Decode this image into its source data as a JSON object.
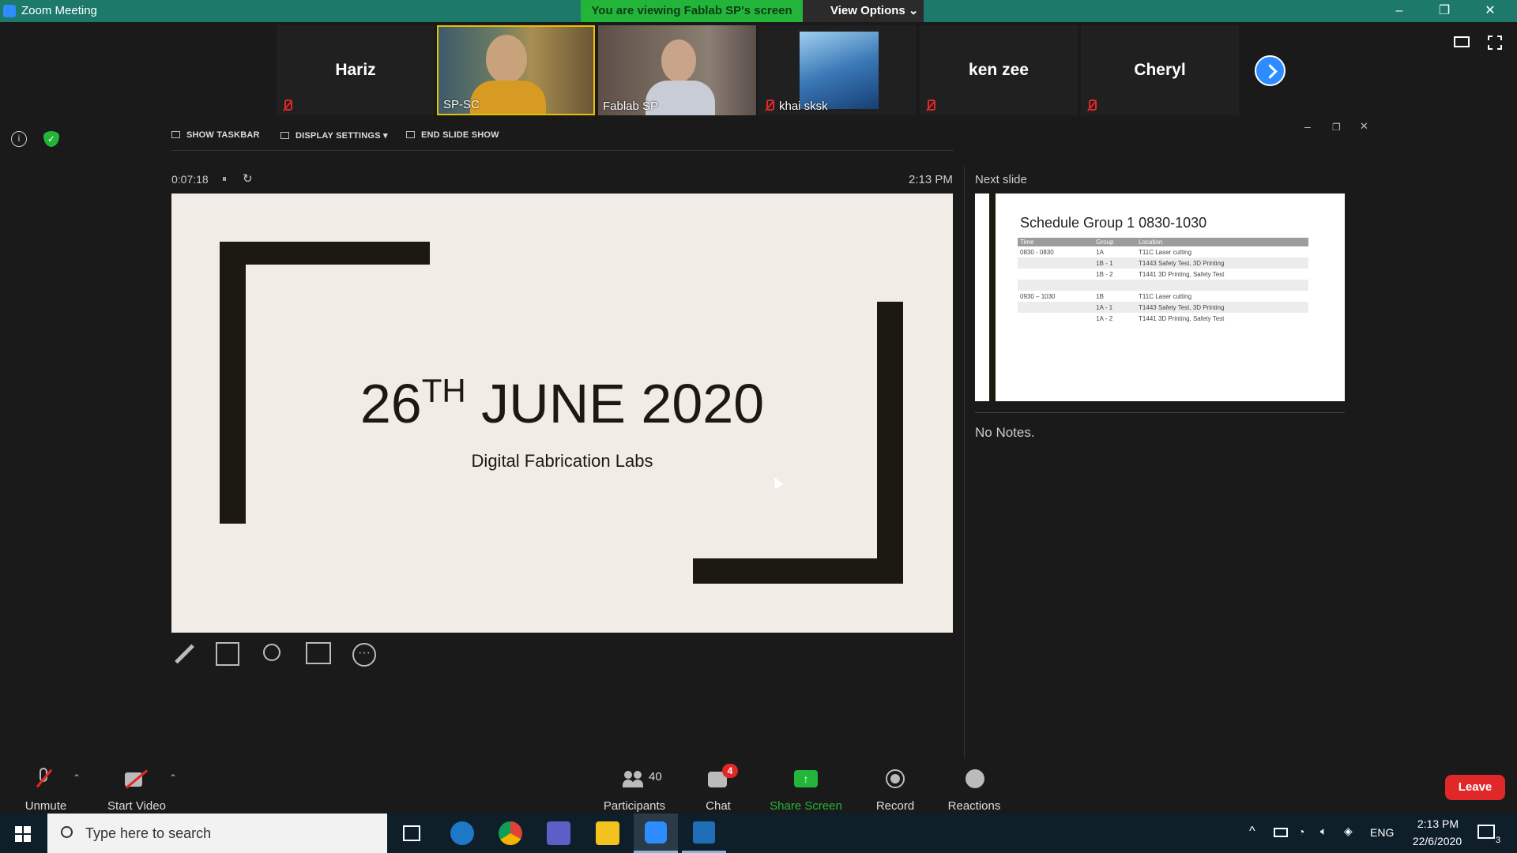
{
  "window": {
    "title": "Zoom Meeting",
    "viewing_banner": "You are viewing Fablab SP's screen",
    "view_options": "View Options ⌄",
    "minimize": "–",
    "restore": "❐",
    "close": "✕"
  },
  "participants_strip": [
    {
      "name": "Hariz",
      "type": "name",
      "muted": true
    },
    {
      "name": "SP-SC",
      "type": "video",
      "muted": false
    },
    {
      "name": "Fablab SP",
      "type": "video",
      "muted": false
    },
    {
      "name": "khai sksk",
      "type": "image",
      "muted": true
    },
    {
      "name": "ken zee",
      "type": "name",
      "muted": true
    },
    {
      "name": "Cheryl",
      "type": "name",
      "muted": true
    }
  ],
  "presenter_controls": {
    "show_taskbar": "SHOW TASKBAR",
    "display_settings": "DISPLAY SETTINGS ▾",
    "end_slide_show": "END SLIDE SHOW",
    "timer": "0:07:18",
    "pause": "⏸",
    "reset": "↻",
    "clock": "2:13 PM",
    "next_slide_label": "Next slide",
    "notes": "No Notes."
  },
  "current_slide": {
    "title_day": "26",
    "title_suffix": "TH",
    "title_rest": " JUNE 2020",
    "subtitle": "Digital Fabrication Labs"
  },
  "next_slide": {
    "title": "Schedule Group 1 0830-1030",
    "headers": [
      "Time",
      "Group",
      "Location"
    ],
    "rows": [
      [
        "0830 - 0830",
        "1A",
        "T11C Laser cutting"
      ],
      [
        "",
        "1B - 1",
        "T1443 Safety Test, 3D Printing"
      ],
      [
        "",
        "1B - 2",
        "T1441 3D Printing, Safety Test"
      ],
      [
        "",
        "",
        ""
      ],
      [
        "0930 – 1030",
        "1B",
        "T11C Laser cutting"
      ],
      [
        "",
        "1A - 1",
        "T1443 Safety Test, 3D Printing"
      ],
      [
        "",
        "1A - 2",
        "T1441 3D Printing, Safety Test"
      ]
    ]
  },
  "toolbar": {
    "unmute": "Unmute",
    "start_video": "Start Video",
    "participants": "Participants",
    "participants_count": "40",
    "chat": "Chat",
    "chat_badge": "4",
    "share_screen": "Share Screen",
    "record": "Record",
    "reactions": "Reactions",
    "leave": "Leave"
  },
  "taskbar": {
    "search_placeholder": "Type here to search",
    "language": "ENG",
    "time": "2:13 PM",
    "date": "22/6/2020",
    "notifications": "3"
  },
  "colors": {
    "accent": "#2d8cff",
    "banner": "#23b53a",
    "leave": "#e02828",
    "share": "#23b53a"
  }
}
